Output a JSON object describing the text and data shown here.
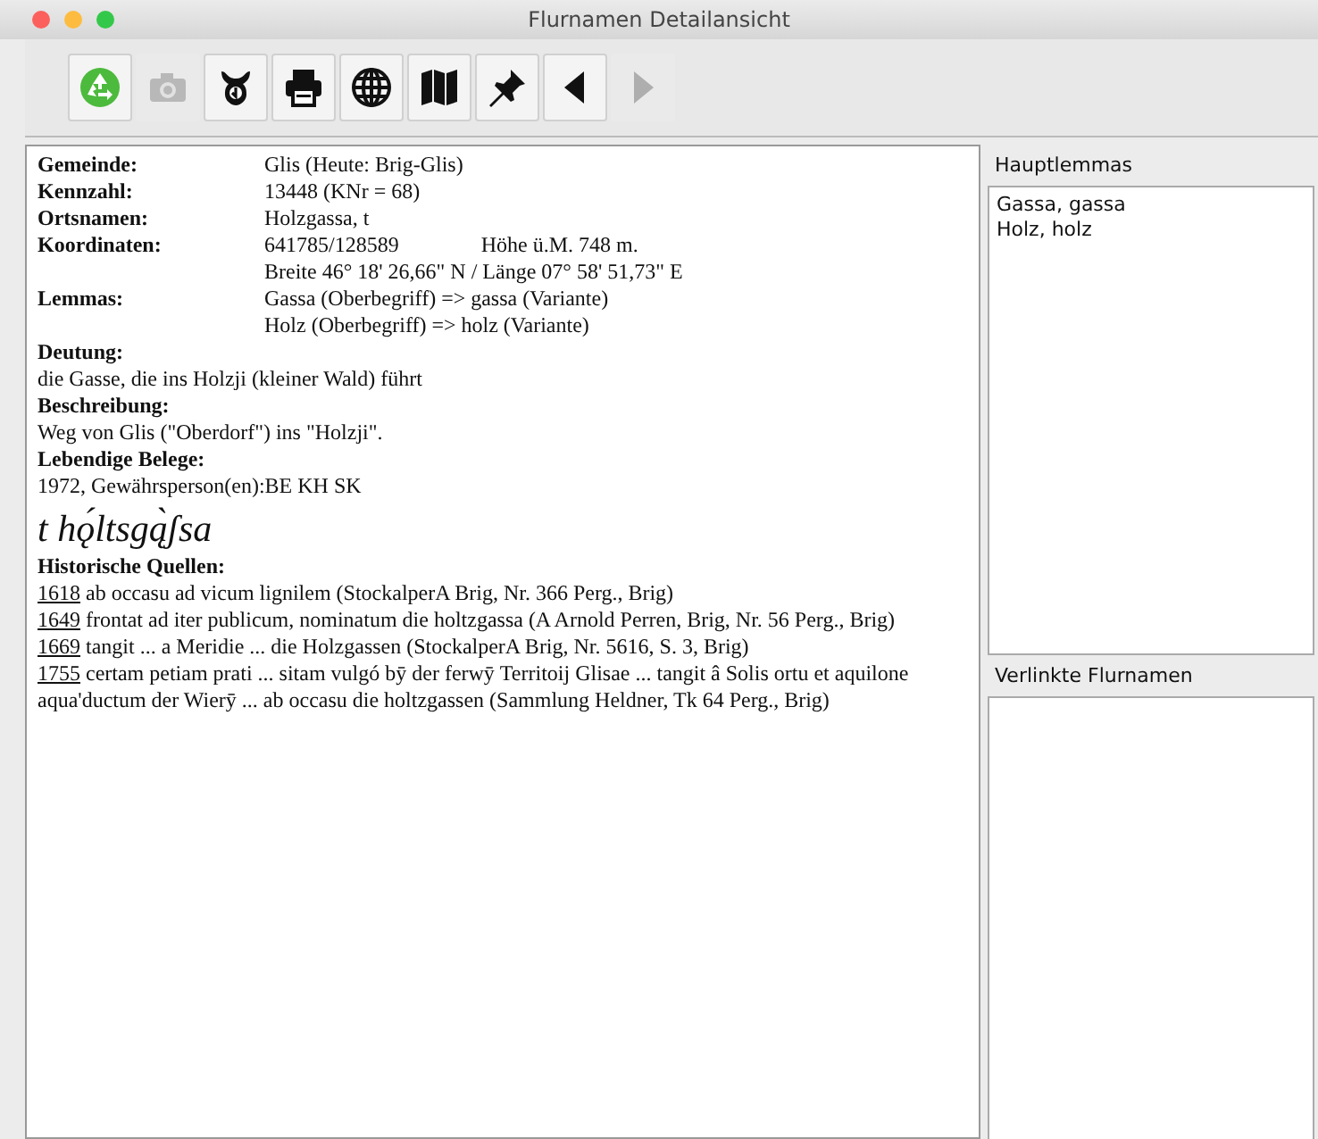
{
  "window": {
    "title": "Flurnamen Detailansicht"
  },
  "toolbar": [
    {
      "kind": "recycle",
      "disabled": false
    },
    {
      "kind": "camera",
      "disabled": true
    },
    {
      "kind": "emblem",
      "disabled": false
    },
    {
      "kind": "print",
      "disabled": false
    },
    {
      "kind": "globe",
      "disabled": false
    },
    {
      "kind": "map",
      "disabled": false
    },
    {
      "kind": "pin",
      "disabled": false
    },
    {
      "kind": "back",
      "disabled": false
    },
    {
      "kind": "forward",
      "disabled": true
    }
  ],
  "details": {
    "fields": [
      {
        "label": "Gemeinde:",
        "lines": [
          [
            "Glis (Heute: Brig-Glis)"
          ]
        ]
      },
      {
        "label": "Kennzahl:",
        "lines": [
          [
            "13448  (KNr = 68)"
          ]
        ]
      },
      {
        "label": "Ortsnamen:",
        "lines": [
          [
            "Holzgassa, t"
          ]
        ]
      },
      {
        "label": "Koordinaten:",
        "lines": [
          [
            "641785/128589",
            "Höhe ü.M. 748 m."
          ],
          [
            "Breite 46° 18' 26,66\" N / Länge 07° 58' 51,73\" E"
          ]
        ]
      },
      {
        "label": "Lemmas:",
        "lines": [
          [
            "Gassa (Oberbegriff) => gassa (Variante)"
          ],
          [
            "Holz (Oberbegriff) => holz (Variante)"
          ]
        ]
      }
    ],
    "sections": [
      {
        "heading": "Deutung:",
        "text": "die Gasse, die ins Holzji (kleiner Wald) führt"
      },
      {
        "heading": "Beschreibung:",
        "text": "Weg von Glis (\"Oberdorf\") ins \"Holzji\"."
      },
      {
        "heading": "Lebendige Belege:",
        "text": "1972, Gewährsperson(en):BE KH SK"
      }
    ],
    "phonetic": "t hǫ́ltsgą̀ʃsa",
    "sources_heading": "Historische Quellen:",
    "sources": [
      {
        "year": "1618",
        "text": "ab occasu ad vicum lignilem (StockalperA Brig, Nr. 366 Perg., Brig)"
      },
      {
        "year": "1649",
        "text": "frontat ad iter publicum, nominatum die holtzgassa (A Arnold Perren, Brig, Nr. 56 Perg., Brig)"
      },
      {
        "year": "1669",
        "text": "tangit ... a Meridie ... die Holzgassen (StockalperA Brig, Nr. 5616, S. 3, Brig)"
      },
      {
        "year": "1755",
        "text": "certam petiam prati ... sitam vulgó bӯ der ferwӯ Territoij Glisae ... tangit â Solis ortu et aquilone aqua'ductum der Wierӯ ... ab occasu die holtzgassen (Sammlung Heldner, Tk 64 Perg., Brig)"
      }
    ]
  },
  "hauptlemmas": {
    "title": "Hauptlemmas",
    "items": [
      "Gassa, gassa",
      "Holz, holz"
    ]
  },
  "verlinkte_flurnamen": {
    "title": "Verlinkte Flurnamen"
  }
}
